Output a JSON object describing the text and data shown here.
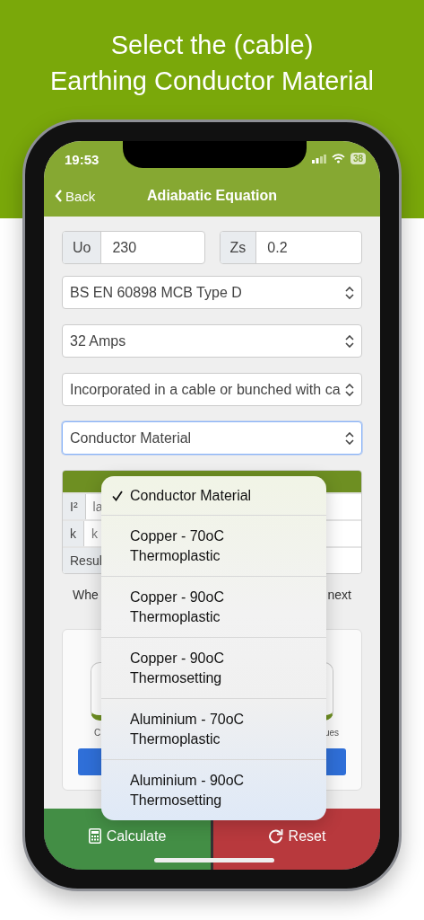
{
  "headline": [
    "Select the (cable)",
    "Earthing Conductor Material"
  ],
  "status_bar": {
    "time": "19:53",
    "battery": "38"
  },
  "nav": {
    "back": "Back",
    "title": "Adiabatic Equation"
  },
  "inputs": [
    {
      "label": "Uo",
      "value": "230"
    },
    {
      "label": "Zs",
      "value": "0.2"
    }
  ],
  "selects": [
    {
      "value": "BS EN 60898 MCB Type D",
      "focused": false
    },
    {
      "value": "32 Amps",
      "focused": false
    },
    {
      "value": "Incorporated in a cable or bunched with ca",
      "focused": false
    },
    {
      "value": "Conductor Material",
      "focused": true
    }
  ],
  "result_table": {
    "rows": [
      {
        "label": "I²",
        "placeholder": "la"
      },
      {
        "label": "k",
        "placeholder": "k"
      },
      {
        "label": "Resul"
      }
    ]
  },
  "note": [
    "Whe",
    "next"
  ],
  "chart_card": {
    "captions": [
      "C",
      "ues"
    ]
  },
  "menu": {
    "items": [
      {
        "label": "Conductor Material",
        "selected": true
      },
      {
        "label": "Copper - 70oC\nThermoplastic",
        "selected": false
      },
      {
        "label": "Copper - 90oC\nThermoplastic",
        "selected": false
      },
      {
        "label": "Copper - 90oC\nThermosetting",
        "selected": false
      },
      {
        "label": "Aluminium - 70oC\nThermoplastic",
        "selected": false
      },
      {
        "label": "Aluminium - 90oC\nThermosetting",
        "selected": false
      }
    ]
  },
  "actions": [
    {
      "label": "Calculate",
      "kind": "calculate"
    },
    {
      "label": "Reset",
      "kind": "reset"
    }
  ]
}
